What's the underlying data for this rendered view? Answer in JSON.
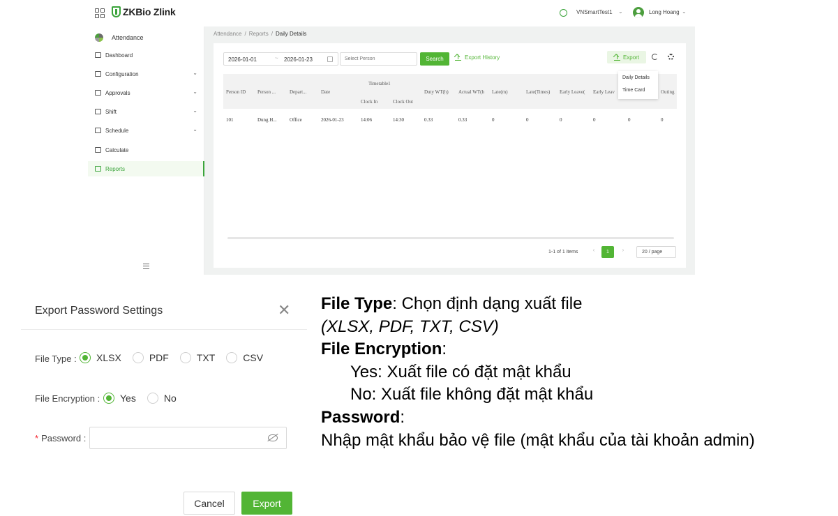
{
  "app": {
    "logo_text": "ZKBio Zlink",
    "tenant": "VNSmartTest1",
    "user_name": "Long Hoang"
  },
  "sidebar": {
    "module": "Attendance",
    "items": [
      {
        "label": "Dashboard",
        "has_caret": false
      },
      {
        "label": "Configuration",
        "has_caret": true
      },
      {
        "label": "Approvals",
        "has_caret": true
      },
      {
        "label": "Shift",
        "has_caret": true
      },
      {
        "label": "Schedule",
        "has_caret": true
      },
      {
        "label": "Calculate",
        "has_caret": false
      },
      {
        "label": "Reports",
        "has_caret": false,
        "active": true
      }
    ]
  },
  "breadcrumb": [
    "Attendance",
    "Reports",
    "Daily Details"
  ],
  "breadcrumb_sep": "/",
  "toolbar": {
    "date_from": "2026-01-01",
    "date_sep": "~",
    "date_to": "2026-01-23",
    "person_placeholder": "Select Person",
    "search_label": "Search",
    "export_history_label": "Export History",
    "export_label": "Export"
  },
  "export_menu": [
    "Daily Details",
    "Time Card"
  ],
  "table": {
    "group_header": "Timetable1",
    "columns": [
      "Person ID",
      "Person ...",
      "Depart...",
      "Date",
      "Clock In",
      "Clock Out",
      "Duty WT(h)",
      "Actual WT(h",
      "Late(m)",
      "Late(Times)",
      "Early Leave(",
      "Early Leav",
      "",
      "Outing"
    ],
    "rows": [
      [
        "101",
        "Dung H...",
        "Office",
        "2026-01-23",
        "14:06",
        "14:30",
        "0.33",
        "0.33",
        "0",
        "0",
        "0",
        "0",
        "0",
        "0"
      ]
    ]
  },
  "pagination": {
    "info": "1-1 of 1 items",
    "prev": "‹",
    "page": "1",
    "next": "›",
    "page_size": "20 / page"
  },
  "dialog": {
    "title": "Export Password Settings",
    "close": "✕",
    "file_type_label": "File Type :",
    "file_types": [
      "XLSX",
      "PDF",
      "TXT",
      "CSV"
    ],
    "file_type_selected": "XLSX",
    "encryption_label": "File Encryption :",
    "encryption_options": [
      "Yes",
      "No"
    ],
    "encryption_selected": "Yes",
    "password_required": "*",
    "password_label": "Password :",
    "cancel_label": "Cancel",
    "export_label": "Export"
  },
  "notes": {
    "file_type_title": "File Type",
    "file_type_desc": ": Chọn định dạng xuất file",
    "file_type_formats": "(XLSX, PDF, TXT, CSV)",
    "encryption_title": "File Encryption",
    "encryption_colon": ":",
    "encryption_yes": "Yes: Xuất file có đặt mật khẩu",
    "encryption_no": "No: Xuất file không đặt mật khẩu",
    "password_title": "Password",
    "password_colon": ":",
    "password_desc": "Nhập mật khẩu bảo vệ file (mật khẩu của tài khoản admin)"
  },
  "colors": {
    "accent": "#52b535",
    "accent_light": "#eaf6e4",
    "required": "#f5222d"
  }
}
